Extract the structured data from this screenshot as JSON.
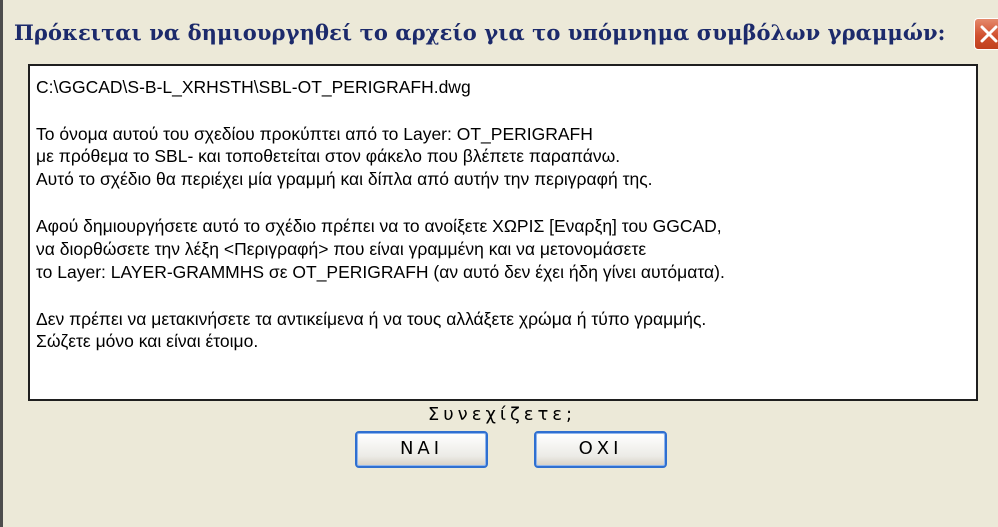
{
  "window": {
    "title": "Πρόκειται να δημιουργηθεί το αρχείο για το υπόμνημα συμβόλων γραμμών:",
    "close_icon": "close-icon",
    "close_color": "#d1502f"
  },
  "message": {
    "lines": [
      "C:\\GGCAD\\S-B-L_XRHSTH\\SBL-OT_PERIGRAFH.dwg",
      "Το όνομα αυτού του σχεδίου προκύπτει από το Layer:  OT_PERIGRAFH",
      "με πρόθεμα το SBL- και τοποθετείται στον φάκελο που βλέπετε παραπάνω.",
      "Αυτό το σχέδιο θα περιέχει μία γραμμή και δίπλα από αυτήν την περιγραφή της.",
      "Αφού δημιουργήσετε αυτό το σχέδιο πρέπει να το ανοίξετε ΧΩΡΙΣ [Εναρξη] του GGCAD,",
      "να διορθώσετε την λέξη <Περιγραφή> που είναι γραμμένη και να μετονομάσετε",
      "το Layer: LAYER-GRAMMHS σε OT_PERIGRAFH (αν αυτό δεν έχει ήδη γίνει αυτόματα).",
      "Δεν πρέπει να μετακινήσετε τα αντικείμενα ή να τους αλλάξετε χρώμα ή τύπο γραμμής.",
      "Σώζετε μόνο και είναι έτοιμο."
    ]
  },
  "prompt": {
    "question": "Συνεχίζετε;",
    "yes_label": "ΝΑΙ",
    "no_label": "ΟΧΙ"
  }
}
